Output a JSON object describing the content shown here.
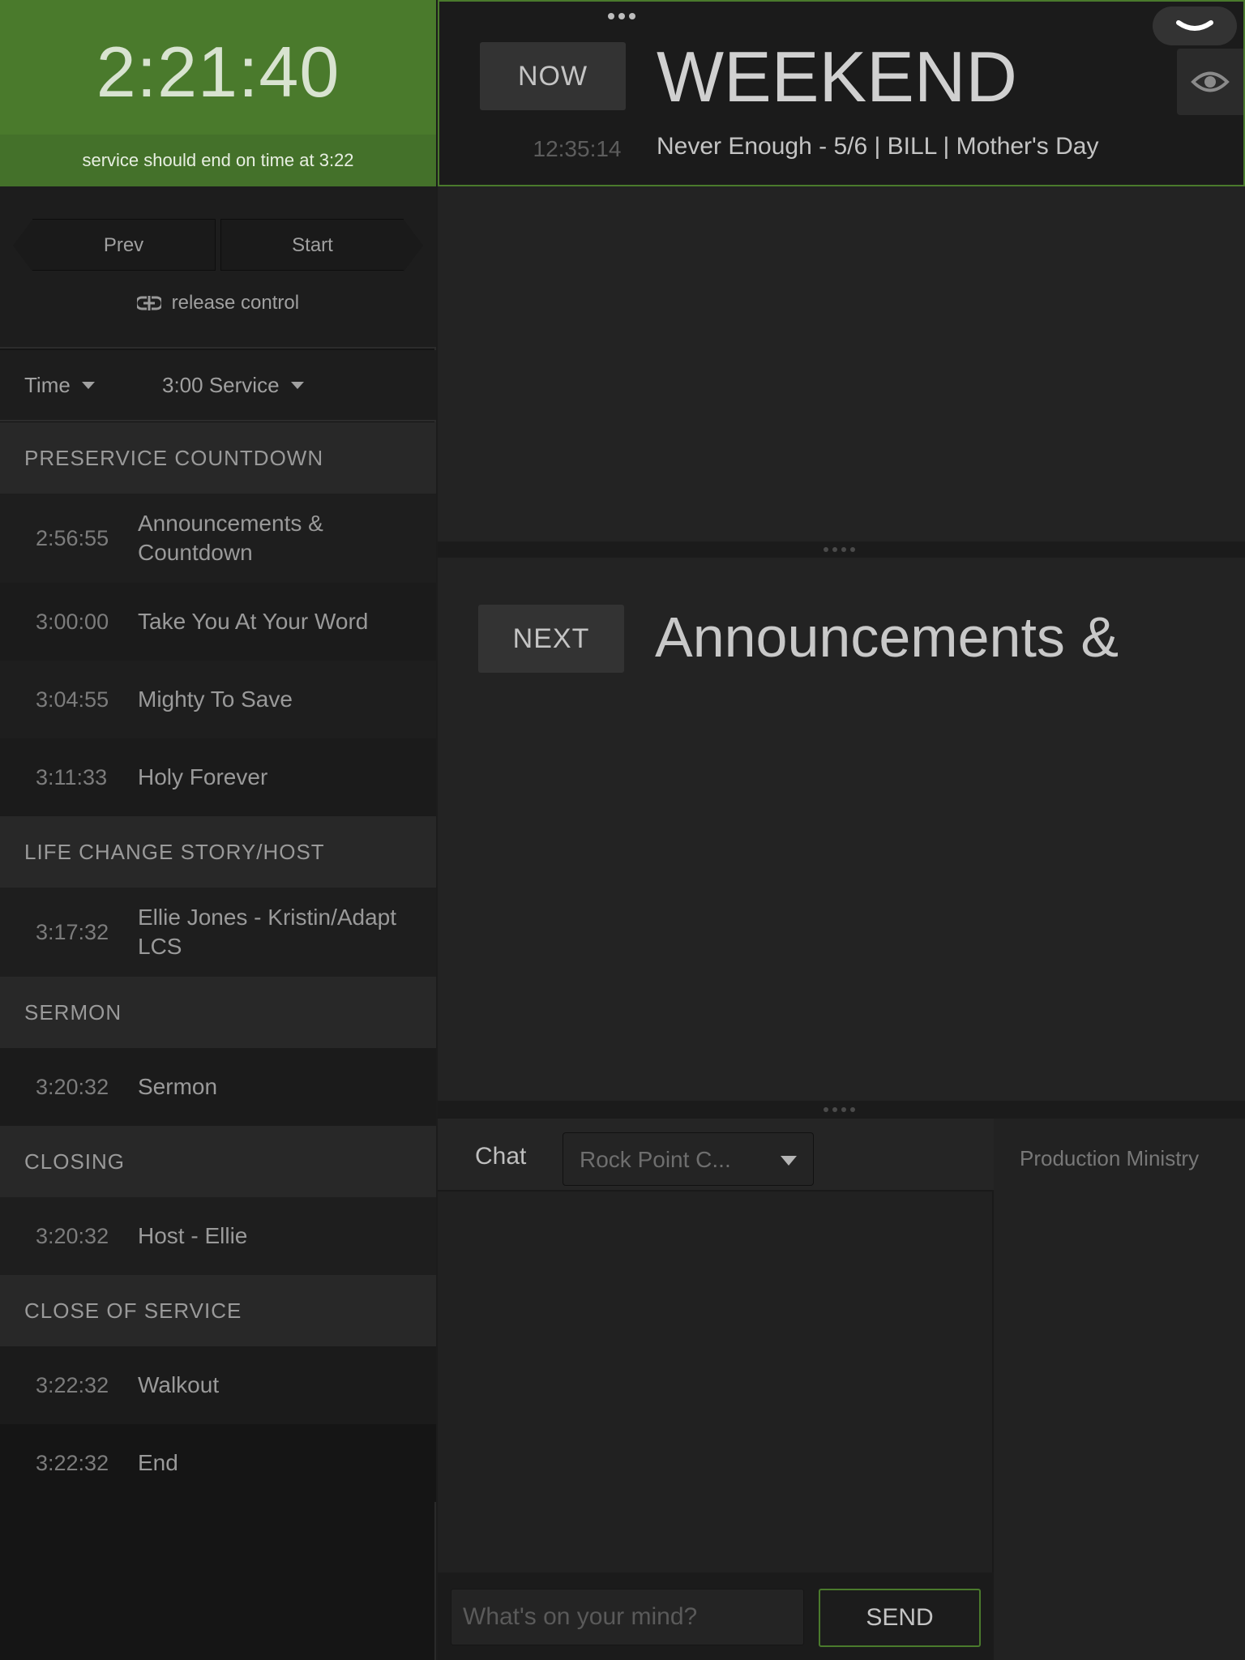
{
  "clock": {
    "time": "2:21:40",
    "status": "service should end on time at 3:22"
  },
  "controls": {
    "prev_label": "Prev",
    "start_label": "Start",
    "release_label": "release control"
  },
  "filters": {
    "time_label": "Time",
    "service_label": "3:00 Service"
  },
  "rundown": [
    {
      "type": "section",
      "label": "PRESERVICE COUNTDOWN"
    },
    {
      "type": "item",
      "time": "2:56:55",
      "name": "Announcements & Countdown"
    },
    {
      "type": "item",
      "time": "3:00:00",
      "name": "Take You At Your Word"
    },
    {
      "type": "item",
      "time": "3:04:55",
      "name": "Mighty To Save"
    },
    {
      "type": "item",
      "time": "3:11:33",
      "name": "Holy Forever"
    },
    {
      "type": "section",
      "label": "LIFE CHANGE STORY/HOST"
    },
    {
      "type": "item",
      "time": "3:17:32",
      "name": "Ellie Jones - Kristin/Adapt LCS"
    },
    {
      "type": "section",
      "label": "SERMON"
    },
    {
      "type": "item",
      "time": "3:20:32",
      "name": "Sermon"
    },
    {
      "type": "section",
      "label": "CLOSING"
    },
    {
      "type": "item",
      "time": "3:20:32",
      "name": "Host - Ellie"
    },
    {
      "type": "section",
      "label": "CLOSE OF SERVICE"
    },
    {
      "type": "item",
      "time": "3:22:32",
      "name": "Walkout"
    },
    {
      "type": "item",
      "time": "3:22:32",
      "name": "End"
    }
  ],
  "now": {
    "tag": "NOW",
    "title": "WEEKEND",
    "time": "12:35:14",
    "subtitle": "Never Enough - 5/6 | BILL | Mother's Day"
  },
  "next": {
    "tag": "NEXT",
    "title": "Announcements &"
  },
  "chat": {
    "label": "Chat",
    "channel": "Rock Point C...",
    "placeholder": "What's on your mind?",
    "send_label": "SEND"
  },
  "team": {
    "label": "Production Ministry"
  },
  "colors": {
    "accent_green": "#4a7a2c",
    "background": "#1c1c1c"
  },
  "icons": {
    "release": "release-control-icon",
    "eye": "eye-icon",
    "collapse": "chevron-down-icon",
    "menu": "more-dots-icon"
  }
}
